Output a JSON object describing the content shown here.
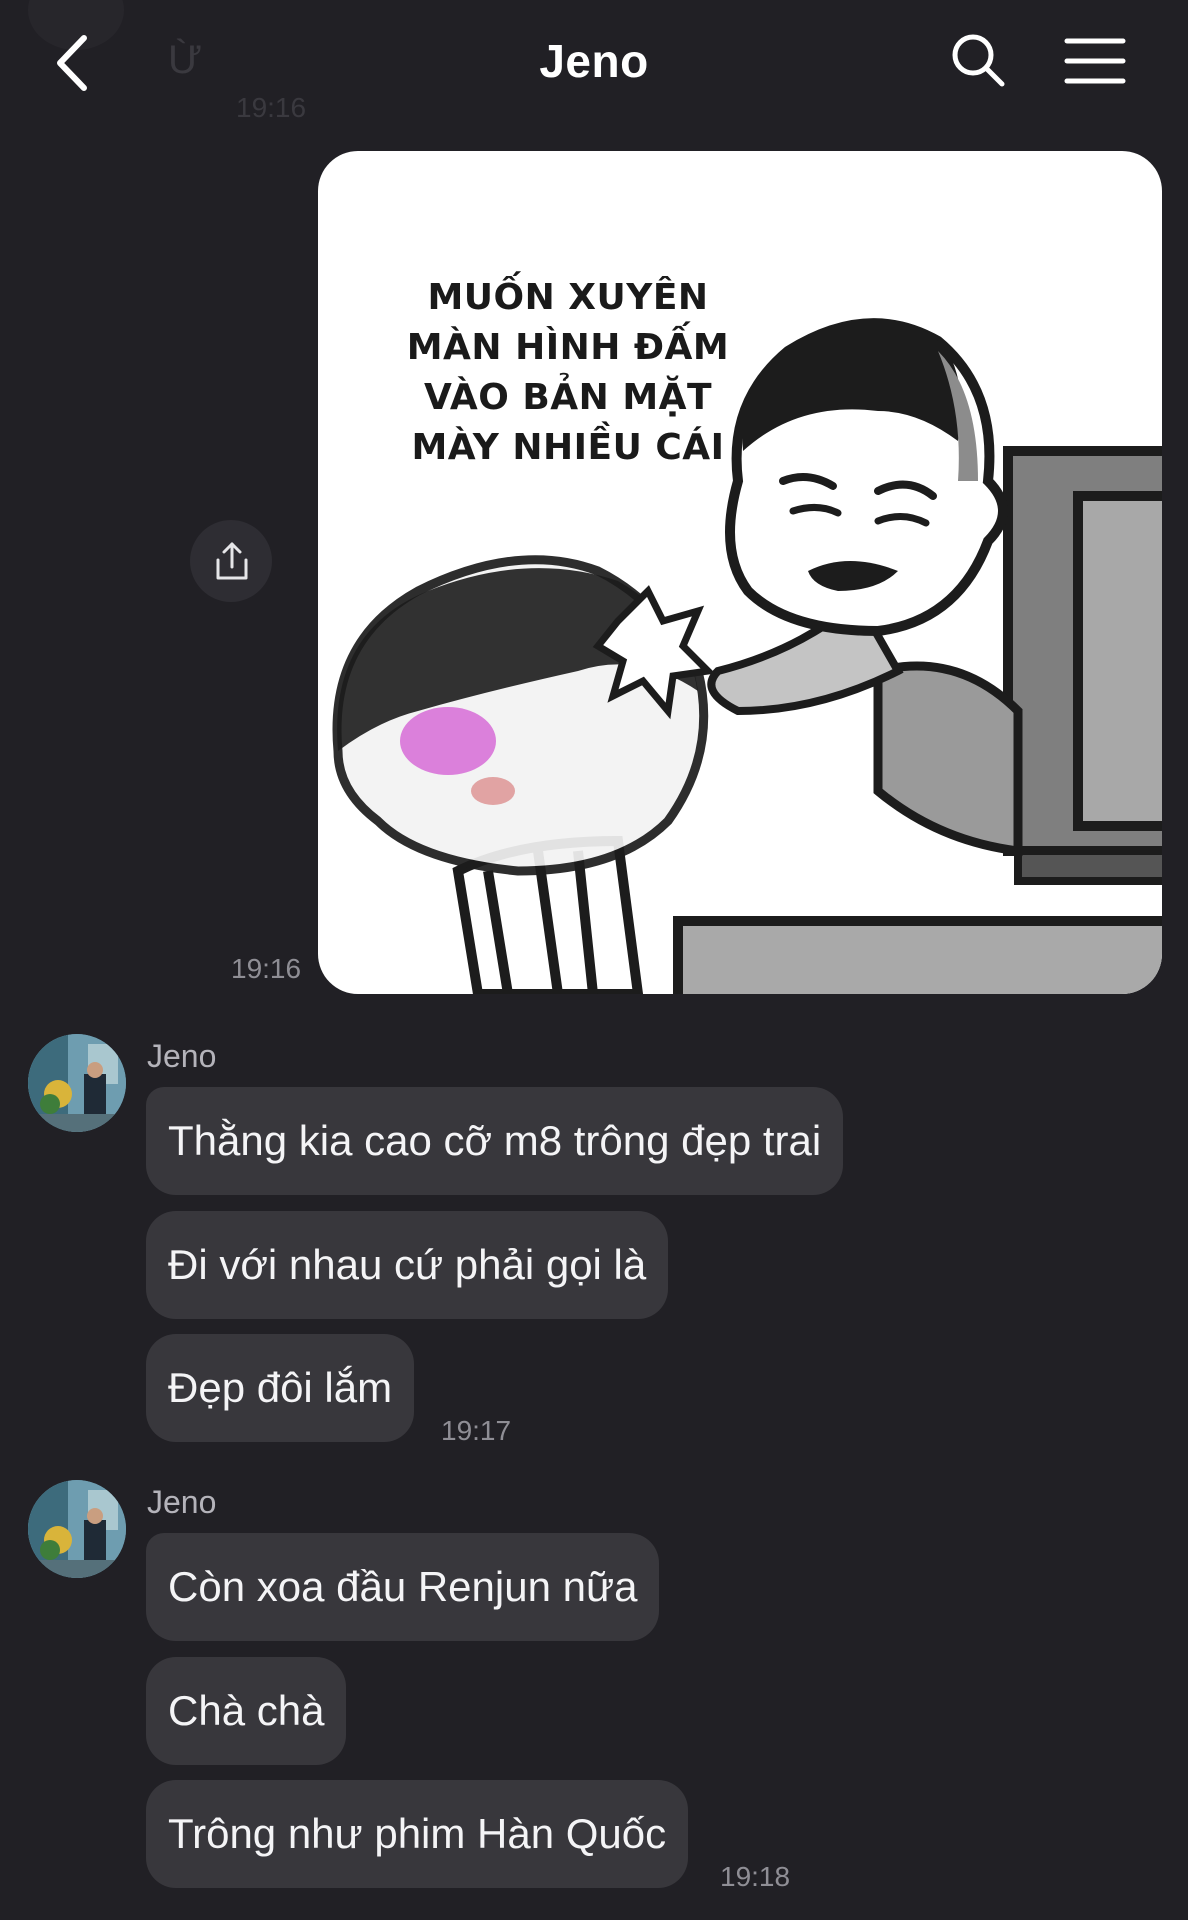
{
  "header": {
    "title": "Jeno",
    "ghost_text": "Ừ",
    "ghost_time": "19:16"
  },
  "meme": {
    "caption_lines": [
      "MUỐN XUYÊN",
      "MÀN HÌNH ĐẤM",
      "VÀO BẢN MẶT",
      "MÀY NHIỀU CÁI"
    ],
    "time": "19:16"
  },
  "groups": [
    {
      "sender": "Jeno",
      "messages": [
        "Thằng kia cao cỡ m8 trông đẹp trai",
        "Đi với nhau cứ phải gọi là",
        "Đẹp đôi lắm"
      ],
      "time": "19:17"
    },
    {
      "sender": "Jeno",
      "messages": [
        "Còn xoa đầu Renjun nữa",
        "Chà chà",
        "Trông như phim Hàn Quốc"
      ],
      "time": "19:18"
    }
  ],
  "icons": {
    "back": "chevron-left-icon",
    "search": "search-icon",
    "menu": "hamburger-menu-icon",
    "share": "share-icon"
  },
  "colors": {
    "background": "#212025",
    "bubble": "#38373c",
    "timestamp": "#8f8e95"
  }
}
